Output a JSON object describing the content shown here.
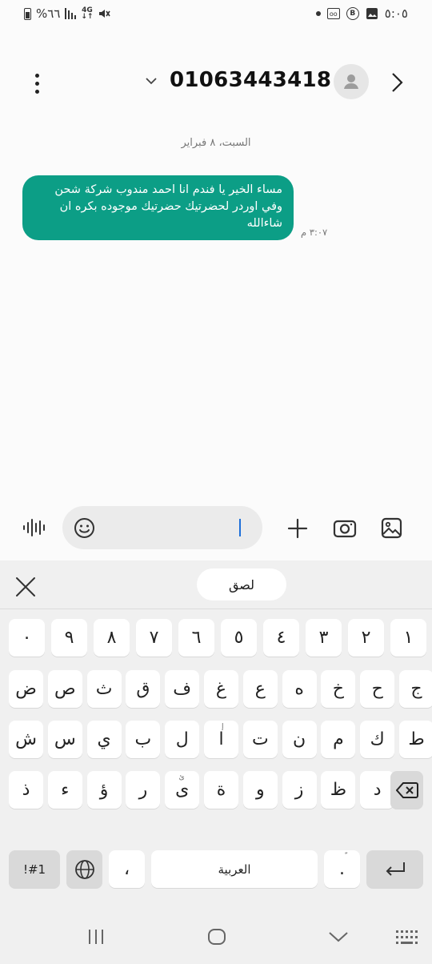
{
  "status_bar": {
    "battery": "%٦٦",
    "network": "4G",
    "time": "٥:٠٥"
  },
  "header": {
    "phone_number": "01063443418"
  },
  "conversation": {
    "date_separator": "السبت، ٨ فبراير",
    "messages": [
      {
        "text": "مساء الخير يا فندم انا احمد مندوب شركة شحن وفي اوردر لحضرتيك حضرتيك موجوده بكره ان شاءالله",
        "time": "٣:٠٧ م"
      }
    ]
  },
  "composer": {
    "placeholder": ""
  },
  "keyboard": {
    "paste_label": "لصق",
    "space_label": "العربية",
    "symbols_label": "!#1",
    "comma": "،",
    "period": ".",
    "period_sup": "ّ",
    "rows": [
      [
        "١",
        "٢",
        "٣",
        "٤",
        "٥",
        "٦",
        "٧",
        "٨",
        "٩",
        "٠"
      ],
      [
        "ض",
        "ص",
        "ث",
        "ق",
        "ف",
        "غ",
        "ع",
        "ه",
        "خ",
        "ح",
        "ج"
      ],
      [
        "ش",
        "س",
        "ي",
        "ب",
        "ل",
        "ا",
        "ت",
        "ن",
        "م",
        "ك",
        "ط"
      ],
      [
        "ذ",
        "ء",
        "ؤ",
        "ر",
        "ى",
        "ة",
        "و",
        "ز",
        "ظ",
        "د"
      ]
    ],
    "row2_superscripts": {
      "ى": "ئ"
    },
    "row1_superscripts": {
      "ا": "إ"
    }
  },
  "colors": {
    "bubble": "#0c9e86",
    "caret": "#1e6fd9"
  }
}
